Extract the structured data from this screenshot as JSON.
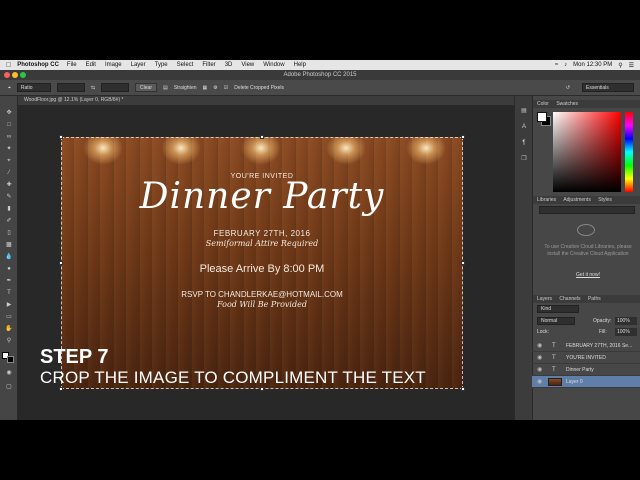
{
  "menubar": {
    "app_name": "Photoshop CC",
    "items": [
      "File",
      "Edit",
      "Image",
      "Layer",
      "Type",
      "Select",
      "Filter",
      "3D",
      "View",
      "Window",
      "Help"
    ],
    "clock": "Mon 12:30 PM"
  },
  "window": {
    "title": "Adobe Photoshop CC 2015"
  },
  "options_bar": {
    "ratio": "Ratio",
    "clear_label": "Clear",
    "straighten_label": "Straighten",
    "delete_cropped_label": "Delete Cropped Pixels",
    "workspace": "Essentials"
  },
  "document": {
    "tab_label": "WoodFloor.jpg @ 12.1% (Layer 0, RGB/8#) *"
  },
  "invitation": {
    "invited": "YOU'RE INVITED",
    "title": "Dinner Party",
    "date": "FEBRUARY 27TH, 2016",
    "attire": "Semiformal Attire Required",
    "arrive": "Please Arrive By 8:00 PM",
    "rsvp": "RSVP TO CHANDLERKAE@HOTMAIL.COM",
    "food": "Food Will Be Provided"
  },
  "overlay": {
    "step": "STEP 7",
    "caption": "CROP THE IMAGE TO COMPLIMENT THE TEXT"
  },
  "panels": {
    "color_tabs": [
      "Color",
      "Swatches"
    ],
    "library_tabs": [
      "Libraries",
      "Adjustments",
      "Styles"
    ],
    "library_message": "To use Creative Cloud Libraries, please install the Creative Cloud Application",
    "library_link": "Get it now!",
    "layer_tabs": [
      "Layers",
      "Channels",
      "Paths"
    ],
    "kind_label": "Kind",
    "blend_mode": "Normal",
    "opacity_label": "Opacity:",
    "opacity_value": "100%",
    "lock_label": "Lock:",
    "fill_label": "Fill:",
    "fill_value": "100%",
    "layers": [
      {
        "type": "text",
        "name": "FEBRUARY 27TH, 2016 Se..."
      },
      {
        "type": "text",
        "name": "YOU'RE INVITED"
      },
      {
        "type": "text",
        "name": "Dinner Party"
      },
      {
        "type": "image",
        "name": "Layer 0",
        "selected": true
      }
    ]
  },
  "colors": {
    "accent_selected_layer": "#5f7ea8",
    "panel_bg": "#474747",
    "canvas_bg": "#282828"
  }
}
